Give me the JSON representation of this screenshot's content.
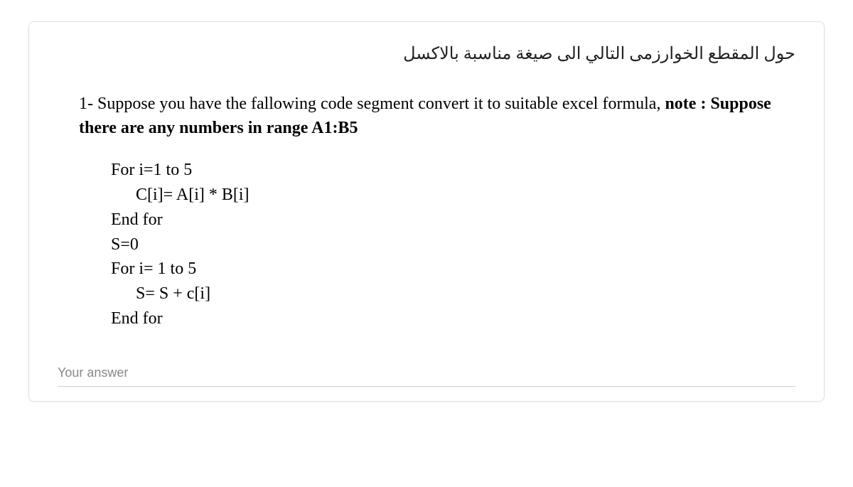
{
  "arabic_title": "حول المقطع الخوارزمى التالي الى صيغة مناسبة بالاكسل",
  "question": {
    "number": "1-",
    "text_part1": "Suppose you have the fallowing code segment convert it to suitable excel formula, ",
    "text_bold": "note : Suppose there are any numbers in   range A1:B5"
  },
  "code": {
    "line1": "For i=1 to 5",
    "line2": "C[i]= A[i] * B[i]",
    "line3": "End for",
    "line4": "S=0",
    "line5": "For i= 1 to  5",
    "line6": "S= S + c[i]",
    "line7": "End for"
  },
  "answer_placeholder": "Your answer"
}
